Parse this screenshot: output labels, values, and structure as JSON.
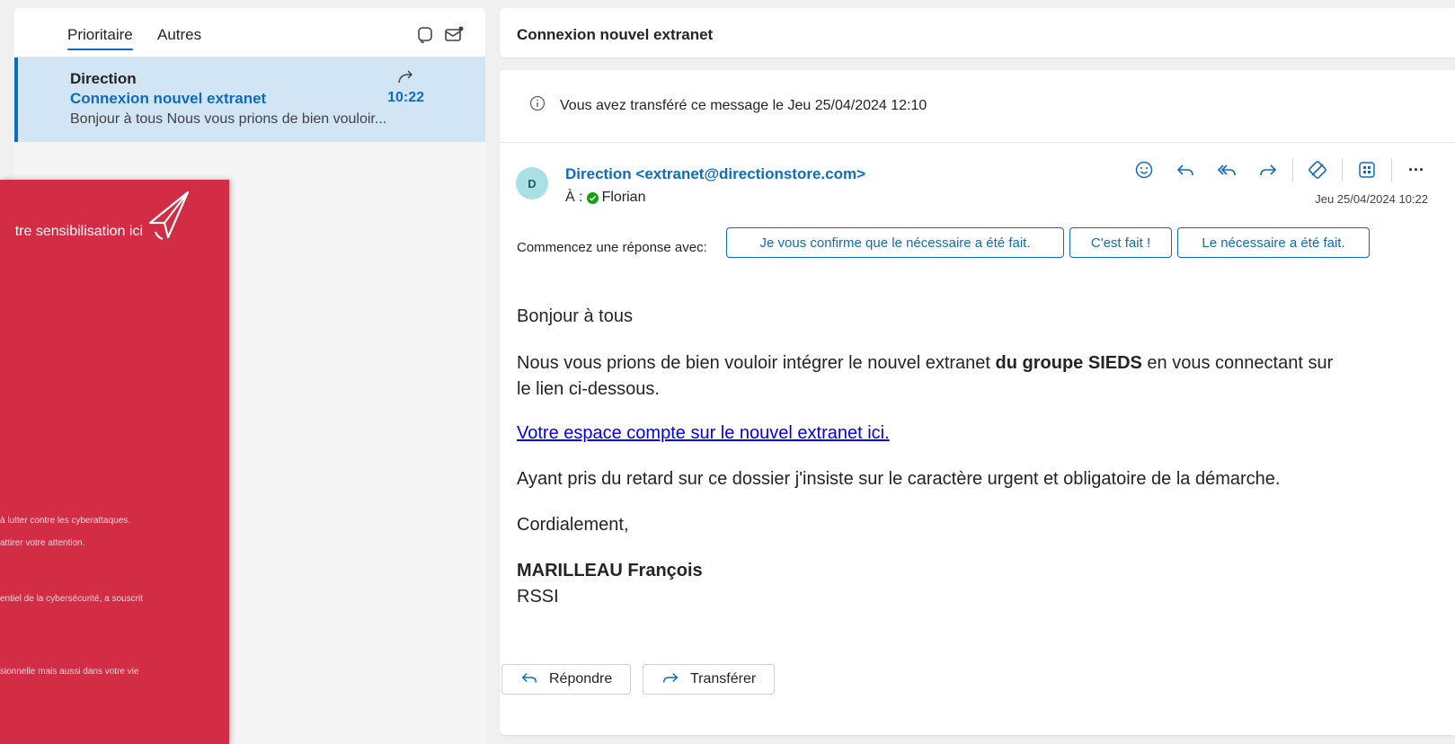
{
  "list": {
    "tabs": [
      "Prioritaire",
      "Autres"
    ],
    "messages": [
      {
        "sender": "Direction",
        "subject": "Connexion nouvel extranet",
        "time": "10:22",
        "preview": "Bonjour à tous Nous vous prions de bien vouloir..."
      }
    ],
    "header_icons": [
      "speech-bubble-icon",
      "mail-unread-icon"
    ]
  },
  "red_panel": {
    "title": "tre sensibilisation ici",
    "lines": [
      "à lutter contre les cyberattaques.",
      "attirer votre attention.",
      "entiel de la cybersécurité, a souscrit",
      "sionnelle mais aussi dans votre vie"
    ]
  },
  "subject_bar": {
    "title": "Connexion nouvel extranet"
  },
  "reading": {
    "info": "Vous avez transféré ce message le Jeu 25/04/2024 12:10",
    "avatar_initial": "D",
    "from": "Direction <extranet@directionstore.com>",
    "to_label": "À :",
    "to_name": "Florian",
    "date": "Jeu 25/04/2024 10:22",
    "suggest_label": "Commencez une réponse avec:",
    "suggestions": [
      "Je vous confirme que le nécessaire a été fait.",
      "C'est fait !",
      "Le nécessaire a été fait."
    ],
    "body": {
      "greeting": "Bonjour à tous",
      "p1_pre": "Nous vous prions de bien vouloir intégrer le nouvel extranet ",
      "p1_bold": "du groupe SIEDS",
      "p1_post": " en vous connectant sur",
      "p1_line2": "le lien ci-dessous.",
      "link": "Votre espace compte sur le nouvel extranet ici.",
      "p2": "Ayant pris du retard sur ce dossier j'insiste sur le caractère urgent et obligatoire de la démarche.",
      "closing": "Cordialement,",
      "signature_name": "MARILLEAU François",
      "signature_role": "RSSI"
    },
    "reply_label": "Répondre",
    "forward_label": "Transférer",
    "more_label": "···"
  }
}
